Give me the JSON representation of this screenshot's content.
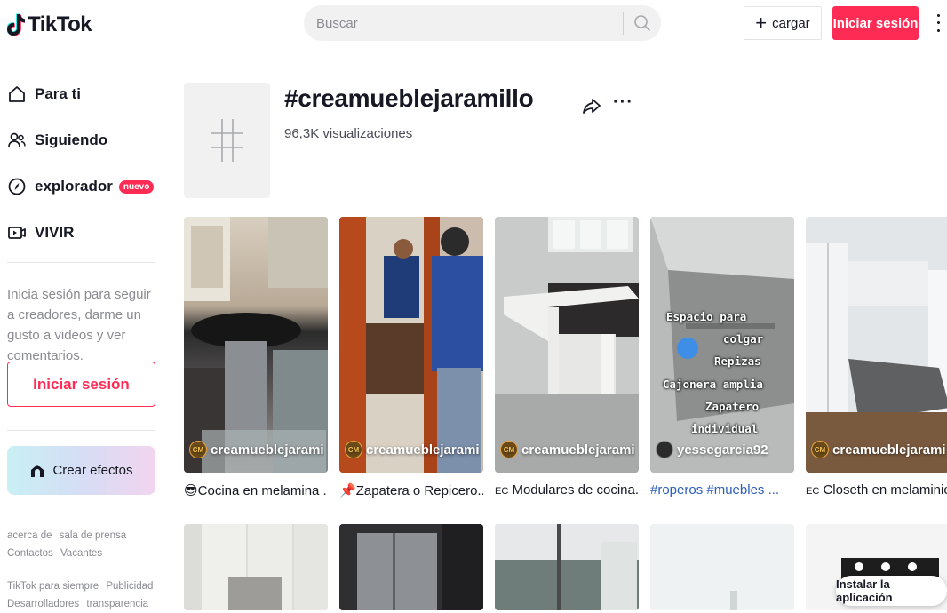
{
  "header": {
    "logo_text": "TikTok",
    "search_placeholder": "Buscar",
    "upload_label": "cargar",
    "login_label": "Iniciar sesión"
  },
  "sidebar": {
    "nav": [
      {
        "label": "Para ti",
        "icon": "home-icon"
      },
      {
        "label": "Siguiendo",
        "icon": "people-icon"
      },
      {
        "label": "explorador",
        "icon": "compass-icon",
        "badge": "nuevo"
      },
      {
        "label": "VIVIR",
        "icon": "live-icon"
      }
    ],
    "login_prompt": "Inicia sesión para seguir a creadores, darme un gusto a videos y ver comentarios.",
    "login_button": "Iniciar sesión",
    "effects_button": "Crear efectos",
    "footer_row1": [
      "acerca de",
      "sala de prensa",
      "Contactos",
      "Vacantes"
    ],
    "footer_row2": [
      "TikTok para siempre",
      "Publicidad",
      "Desarrolladores",
      "transparencia"
    ]
  },
  "hashtag": {
    "title": "#creamueblejaramillo",
    "views": "96,3K visualizaciones"
  },
  "videos": [
    {
      "author": "creamueblejarami...",
      "caption": "Cocina en melamina ...",
      "caption_prefix": "😎"
    },
    {
      "author": "creamueblejarami...",
      "caption": "Zapatera o Repicero...",
      "caption_prefix": "📌"
    },
    {
      "author": "creamueblejarami...",
      "caption": "Modulares de cocina...",
      "caption_prefix": "EC"
    },
    {
      "author": "yessegarcia92",
      "caption": "#roperos #muebles ...",
      "caption_prefix": "",
      "overlay": [
        "Espacio para",
        "colgar",
        "Repizas",
        "Cajonera amplia",
        "Zapatero",
        "individual"
      ]
    },
    {
      "author": "creamueblejarami...",
      "caption": "Closeth en melaminic...",
      "caption_prefix": "EC"
    }
  ],
  "install_label": "Instalar la aplicación",
  "colors": {
    "brand": "#fe2c55",
    "text": "#161823",
    "muted": "#8a8b91",
    "hashtag_link": "#2b5db9"
  }
}
